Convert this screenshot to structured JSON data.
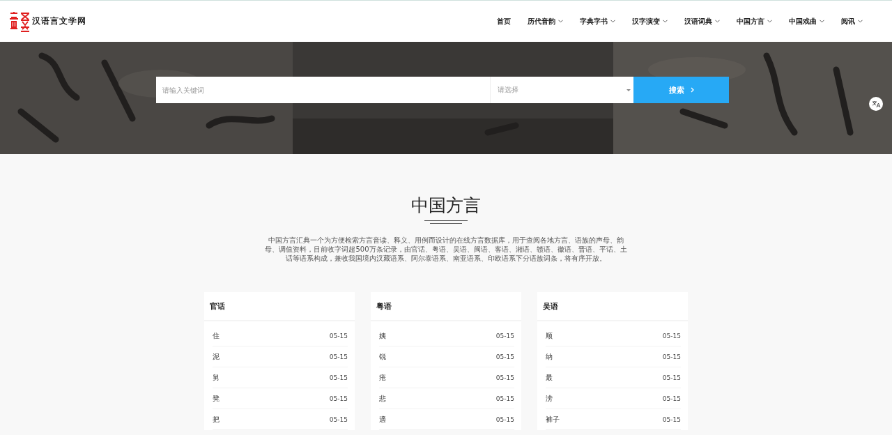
{
  "logo": {
    "text": "汉语言文学网"
  },
  "nav": [
    {
      "label": "首页",
      "dropdown": false
    },
    {
      "label": "历代音韵",
      "dropdown": true
    },
    {
      "label": "字典字书",
      "dropdown": true
    },
    {
      "label": "汉字演变",
      "dropdown": true
    },
    {
      "label": "汉语词典",
      "dropdown": true
    },
    {
      "label": "中国方言",
      "dropdown": true
    },
    {
      "label": "中国戏曲",
      "dropdown": true
    },
    {
      "label": "阅讯",
      "dropdown": true
    }
  ],
  "search": {
    "placeholder": "请输入关键词",
    "select_placeholder": "请选择",
    "button": "搜索"
  },
  "section": {
    "title": "中国方言",
    "description": "中国方言汇典一个为方便检索方言音读、释义、用例而设计的在线方言数据库，用于查阅各地方言、语族的声母、韵母、调值资料，目前收字词超500万条记录，由官话、粤语、吴语、闽语、客语、湘语、赣语、徽语、晋语、平话、土话等语系构成，兼收我国境内汉藏语系、阿尔泰语系、南亚语系、印欧语系下分语族词条，将有序开放。"
  },
  "cards": [
    {
      "title": "官话",
      "entries": [
        {
          "word": "住",
          "date": "05-15"
        },
        {
          "word": "泥",
          "date": "05-15"
        },
        {
          "word": "舅",
          "date": "05-15"
        },
        {
          "word": "凳",
          "date": "05-15"
        },
        {
          "word": "把",
          "date": "05-15"
        }
      ]
    },
    {
      "title": "粤语",
      "entries": [
        {
          "word": "姨",
          "date": "05-15"
        },
        {
          "word": "锐",
          "date": "05-15"
        },
        {
          "word": "疮",
          "date": "05-15"
        },
        {
          "word": "悲",
          "date": "05-15"
        },
        {
          "word": "適",
          "date": "05-15"
        }
      ]
    },
    {
      "title": "吴语",
      "entries": [
        {
          "word": "顺",
          "date": "05-15"
        },
        {
          "word": "纳",
          "date": "05-15"
        },
        {
          "word": "最",
          "date": "05-15"
        },
        {
          "word": "涝",
          "date": "05-15"
        },
        {
          "word": "裤子",
          "date": "05-15"
        }
      ]
    }
  ]
}
